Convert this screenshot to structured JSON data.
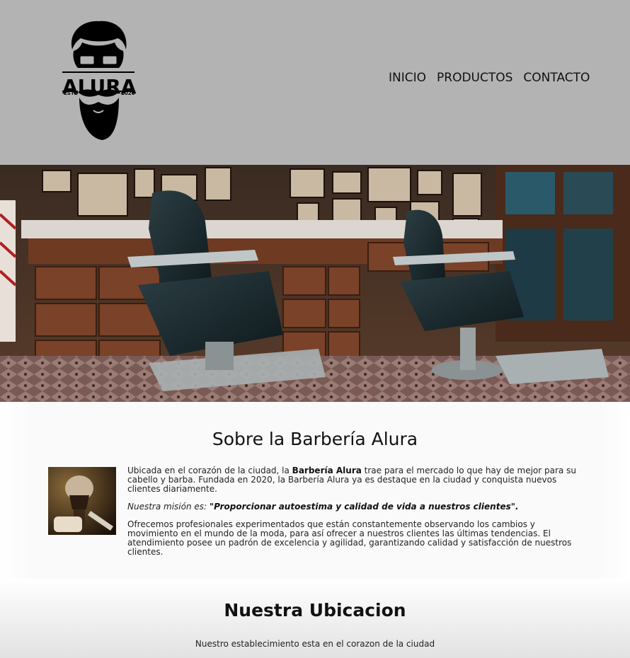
{
  "header": {
    "logo": {
      "name": "ALURA",
      "estd": "ESTD",
      "year": "2020",
      "icon": "barber-face-logo-icon"
    },
    "nav": [
      {
        "label": "INICIO"
      },
      {
        "label": "PRODUCTOS"
      },
      {
        "label": "CONTACTO"
      }
    ]
  },
  "hero": {
    "image": "barbershop-interior-photo"
  },
  "about": {
    "title": "Sobre la Barbería Alura",
    "image": "shaving-brush-razor-photo",
    "p1_before": "Ubicada en el corazón de la ciudad, la ",
    "p1_strong": "Barbería Alura",
    "p1_after": " trae para el mercado lo que hay de mejor para su cabello y barba. Fundada en 2020, la Barbería Alura ya es destaque en la ciudad y conquista nuevos clientes diariamente.",
    "p2_em": "Nuestra misión es: ",
    "p2_strong": "\"Proporcionar autoestima y calidad de vida a nuestros clientes\".",
    "p3": "Ofrecemos profesionales experimentados que están constantemente observando los cambios y movimiento en el mundo de la moda, para así ofrecer a nuestros clientes las últimas tendencias. El atendimiento posee un padrón de excelencia y agilidad, garantizando calidad y satisfacción de nuestros clientes."
  },
  "location": {
    "title": "Nuestra Ubicacion",
    "subtitle": "Nuestro establecimiento esta en el corazon de la ciudad"
  },
  "colors": {
    "header_bg": "#b3b3b3",
    "text": "#111111",
    "wood": "#6e3a22",
    "leather": "#1a2a2e"
  }
}
